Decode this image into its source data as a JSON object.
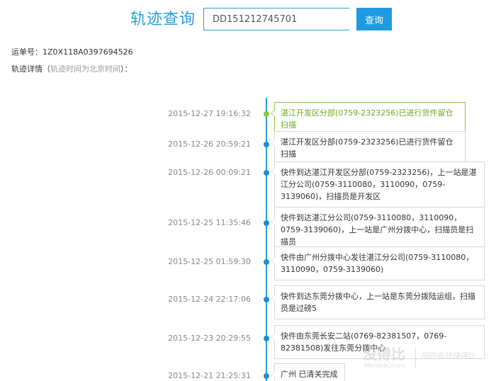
{
  "header": {
    "title": "轨迹查询",
    "search_value": "DD151212745701",
    "search_button_label": "查询"
  },
  "info": {
    "waybill_label": "运单号：",
    "waybill_number": "1Z0X118A0397694526",
    "track_label": "轨迹详情（",
    "track_note": "轨迹时间为北京时间",
    "track_suffix": "）："
  },
  "timeline": [
    {
      "time": "2015-12-27 19:16:32",
      "text": "湛江开发区分部(0759-2323256)已进行货件留仓扫描",
      "current": true
    },
    {
      "time": "2015-12-26 20:59:21",
      "text": "湛江开发区分部(0759-2323256)已进行货件留仓扫描",
      "current": false
    },
    {
      "time": "2015-12-26 00:09:21",
      "text": "快件到达湛江开发区分部(0759-2323256)，上一站是湛江分公司(0759-3110080，3110090，0759-3139060)，扫描员是开发区",
      "current": false
    },
    {
      "time": "2015-12-25 11:35:46",
      "text": "快件到达湛江分公司(0759-3110080，3110090，0759-3139060)，上一站是广州分拨中心，扫描员是扫描员",
      "current": false
    },
    {
      "time": "2015-12-25 01:59:30",
      "text": "快件由广州分拨中心发往湛江分公司(0759-3110080，3110090，0759-3139060)",
      "current": false
    },
    {
      "time": "2015-12-24 22:17:06",
      "text": "快件到达东莞分拨中心，上一站是东莞分拨陆运组，扫描员是过磅5",
      "current": false
    },
    {
      "time": "2015-12-23 20:29:55",
      "text": "快件由东莞长安二站(0769-82381507，0769-82381508)发往东莞分拨中心",
      "current": false
    },
    {
      "time": "2015-12-21 21:25:31",
      "text": "广州 已清关完成",
      "current": false
    }
  ],
  "watermark": {
    "main": "没得比",
    "domain": "Meidebi.com",
    "slogan": "网购有钱赚得比"
  },
  "colors": {
    "accent": "#2a9fd8",
    "button": "#1e9ae0",
    "current": "#8dc63f"
  }
}
